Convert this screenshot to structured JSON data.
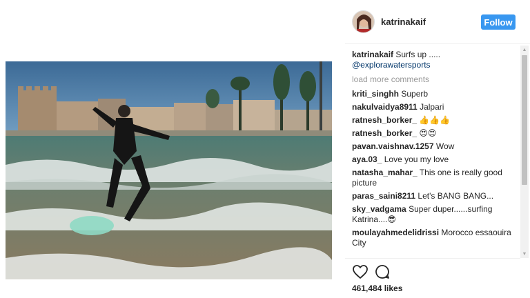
{
  "post": {
    "image_alt": "Woman surfing in a black wetsuit",
    "username": "katrinakaif",
    "follow_label": "Follow"
  },
  "caption": {
    "username": "katrinakaif",
    "text": "Surfs up .....",
    "mention": "@explorawatersports"
  },
  "load_more": "load more comments",
  "comments": [
    {
      "username": "kriti_singhh",
      "text": "Superb"
    },
    {
      "username": "nakulvaidya8911",
      "text": "Jalpari"
    },
    {
      "username": "ratnesh_borker_",
      "text": "👍👍👍"
    },
    {
      "username": "ratnesh_borker_",
      "text": "😍😍"
    },
    {
      "username": "pavan.vaishnav.1257",
      "text": "Wow"
    },
    {
      "username": "aya.03_",
      "text": "Love you my love"
    },
    {
      "username": "natasha_mahar_",
      "text": "This one is really good picture"
    },
    {
      "username": "paras_saini8211",
      "text": "Let's BANG BANG..."
    },
    {
      "username": "sky_vadgama",
      "text": "Super duper......surfing Katrina....😎"
    },
    {
      "username": "moulayahmedelidrissi",
      "text": "Morocco essaouira City"
    }
  ],
  "likes": "461,484 likes",
  "icons": {
    "heart": "heart-icon",
    "comment": "comment-icon",
    "scroll_up": "scroll-up-arrow-icon",
    "scroll_down": "scroll-down-arrow-icon"
  },
  "colors": {
    "follow_button": "#3897f0",
    "link": "#003569",
    "muted": "#999999"
  }
}
